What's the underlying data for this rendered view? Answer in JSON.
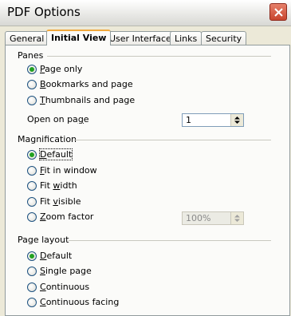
{
  "window": {
    "title": "PDF Options"
  },
  "tabs": [
    {
      "label": "General"
    },
    {
      "label": "Initial View",
      "active": true
    },
    {
      "label": "User Interface"
    },
    {
      "label": "Links"
    },
    {
      "label": "Security"
    }
  ],
  "panes": {
    "label": "Panes",
    "options": [
      {
        "mn": "P",
        "rest": "age only",
        "selected": true
      },
      {
        "mn": "B",
        "rest": "ookmarks and page"
      },
      {
        "mn": "T",
        "rest": "humbnails and page"
      }
    ],
    "open_on_page": {
      "label_a": "Open on pa",
      "mn": "g",
      "label_b": "e",
      "value": "1"
    }
  },
  "magnification": {
    "label": "Magnification",
    "options": [
      {
        "mn": "D",
        "rest": "efault",
        "selected": true
      },
      {
        "mn": "F",
        "rest": "it in window"
      },
      {
        "pre": "Fit ",
        "mn": "w",
        "rest": "idth"
      },
      {
        "pre": "Fit ",
        "mn": "v",
        "rest": "isible"
      },
      {
        "mn": "Z",
        "rest": "oom factor"
      }
    ],
    "zoom_value": "100%"
  },
  "page_layout": {
    "label": "Page layout",
    "options": [
      {
        "mn": "D",
        "rest": "efault",
        "selected": true
      },
      {
        "mn": "S",
        "rest": "ingle page"
      },
      {
        "mn": "C",
        "rest": "ontinuous"
      },
      {
        "mn": "C",
        "rest": "ontinuous facing"
      }
    ]
  },
  "colors": {
    "accent_tab": "#f1a83c",
    "radio_on": "#21a121",
    "close_button": "#c8452d"
  }
}
